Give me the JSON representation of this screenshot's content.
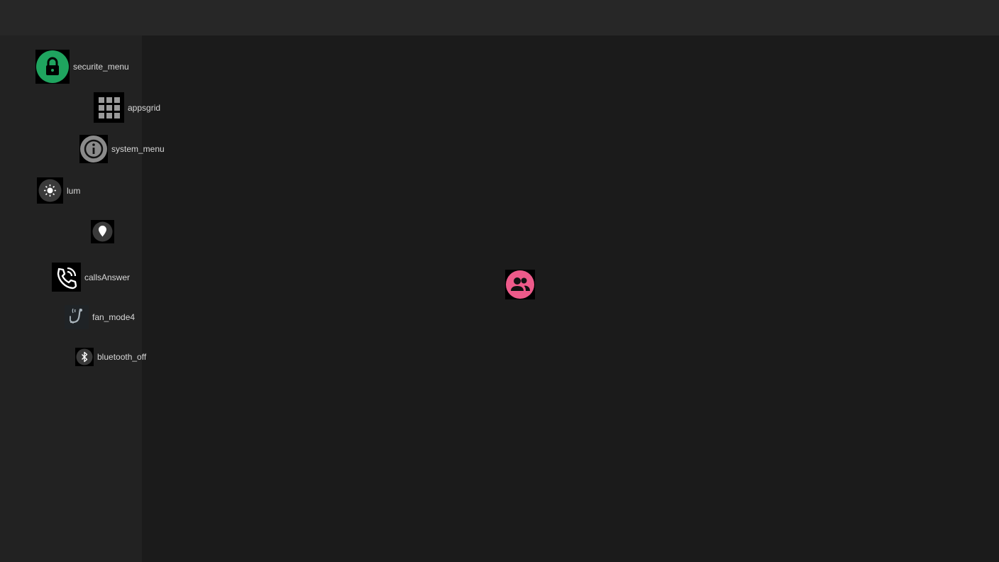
{
  "colors": {
    "topbar": "#272727",
    "sidebar": "#222222",
    "canvas": "#1b1b1b",
    "label": "#d8d8d8",
    "lock_accent": "#1fa45f",
    "contacts_accent": "#ee5a8a"
  },
  "items": [
    {
      "label": "securite_menu",
      "icon": "lock-icon"
    },
    {
      "label": "appsgrid",
      "icon": "apps-grid-icon"
    },
    {
      "label": "system_menu",
      "icon": "info-icon"
    },
    {
      "label": "lum",
      "icon": "brightness-icon"
    },
    {
      "label": "",
      "icon": "location-pin-icon"
    },
    {
      "label": "callsAnswer",
      "icon": "phone-answer-icon"
    },
    {
      "label": "fan_mode4",
      "icon": "fan-mode-icon"
    },
    {
      "label": "bluetooth_off",
      "icon": "bluetooth-off-icon"
    }
  ],
  "canvas_widget": {
    "icon": "contacts-icon"
  }
}
